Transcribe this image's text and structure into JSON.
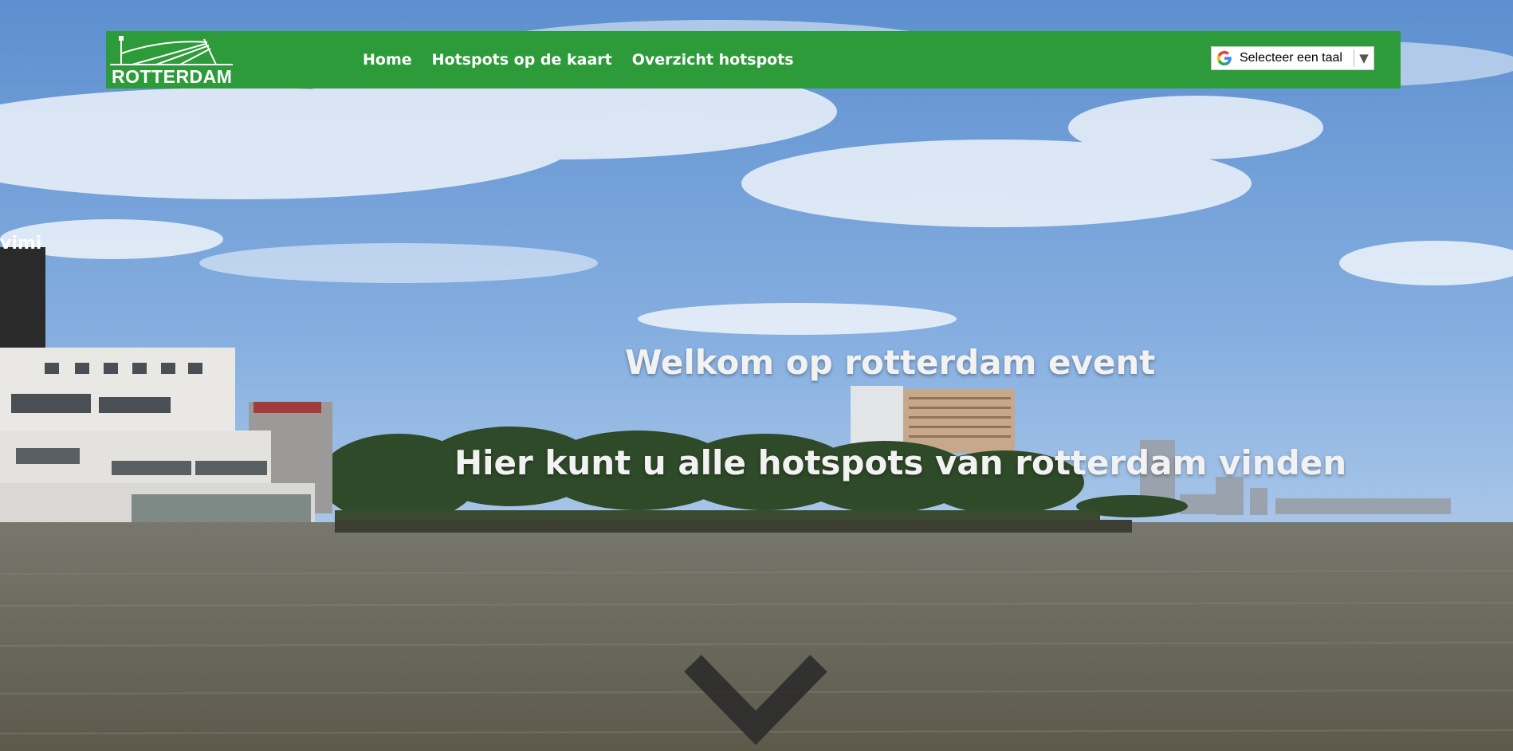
{
  "page": {
    "brand_color": "#2d9b3a"
  },
  "navbar": {
    "logo_text": "ROTTERDAM",
    "links": [
      {
        "label": "Home"
      },
      {
        "label": "Hotspots op de kaart"
      },
      {
        "label": "Overzicht hotspots"
      }
    ]
  },
  "translate_widget": {
    "label": "Selecteer een taal",
    "caret": "▼",
    "icon": "google-g-icon"
  },
  "hero": {
    "welcome": "Welkom op rotterdam event",
    "subtitle": "Hier kunt u alle hotspots van rotterdam vinden",
    "scroll_icon": "chevron-down-icon",
    "building_sign": "vimi"
  }
}
